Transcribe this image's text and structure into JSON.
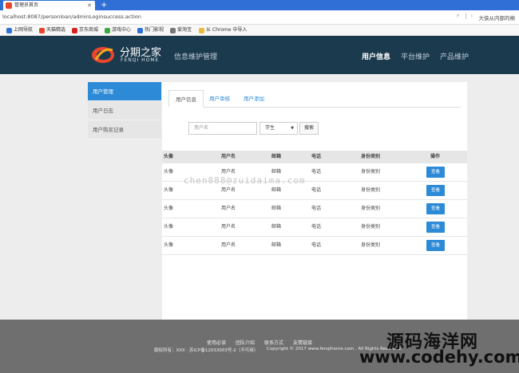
{
  "browser": {
    "tab_title": "管理员首页",
    "new_tab": "+",
    "url": "localhost:8087/personloan/adminLoginsuccess.action",
    "addr_right": "大侠从内部的棉",
    "bookmarks": [
      {
        "label": "上网导航",
        "color": "#2f6fd6"
      },
      {
        "label": "天猫精选",
        "color": "#e8452b"
      },
      {
        "label": "京东商城",
        "color": "#d42222"
      },
      {
        "label": "游戏中心",
        "color": "#40a944"
      },
      {
        "label": "热门影视",
        "color": "#2f6fd6"
      },
      {
        "label": "爱淘宝",
        "color": "#777777"
      },
      {
        "label": "从 Chrome 中导入",
        "color": "#e9b93a"
      }
    ]
  },
  "header": {
    "logo_cn": "分期之家",
    "logo_en": "FENQI HOME",
    "system_title": "信息维护管理",
    "nav": [
      "用户信息",
      "平台维护",
      "产品维护"
    ],
    "nav_active": 0
  },
  "sidebar": {
    "items": [
      "用户管理",
      "用户日志",
      "用户购买记录"
    ],
    "active": 0
  },
  "tabs": {
    "items": [
      "用户信息",
      "用户审核",
      "用户添加"
    ],
    "active": 0
  },
  "search": {
    "placeholder": "用户名",
    "select_value": "学生",
    "button": "搜索"
  },
  "table": {
    "headers": [
      "头像",
      "用户名",
      "邮箱",
      "电话",
      "身份类别",
      "操作"
    ],
    "rows": [
      [
        "头像",
        "用户名",
        "邮箱",
        "电话",
        "身份类别",
        "查看"
      ],
      [
        "头像",
        "用户名",
        "邮箱",
        "电话",
        "身份类别",
        "查看"
      ],
      [
        "头像",
        "用户名",
        "邮箱",
        "电话",
        "身份类别",
        "查看"
      ],
      [
        "头像",
        "用户名",
        "邮箱",
        "电话",
        "身份类别",
        "查看"
      ],
      [
        "头像",
        "用户名",
        "邮箱",
        "电话",
        "身份类别",
        "查看"
      ]
    ]
  },
  "watermark": "chen888@zuidaima.com",
  "footer": {
    "links": [
      "使用必读",
      "团队介绍",
      "联系方式",
      "友情链接"
    ],
    "copyright_left": "版权所有：XXX · 苏ICP备12033003号-2（不可用）",
    "copyright_right": "Copyright © 2017 www.fenqihome.com . All Rights Reserved."
  },
  "overlay": {
    "brand_cn": "源码海洋网",
    "brand_url": "www.codehy.com"
  },
  "colors": {
    "header_bg": "#1c3a4e",
    "accent": "#2d8ad6",
    "footer_bg": "#6f6f6f"
  }
}
